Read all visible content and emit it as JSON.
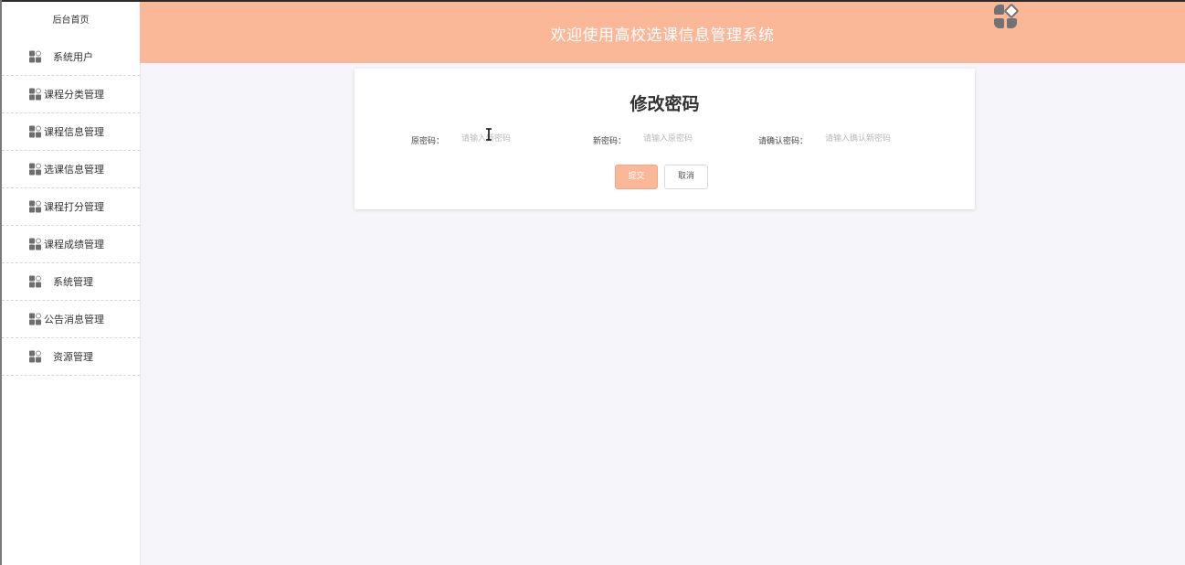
{
  "sidebar": {
    "home": "后台首页",
    "items": [
      {
        "label": "系统用户"
      },
      {
        "label": "课程分类管理"
      },
      {
        "label": "课程信息管理"
      },
      {
        "label": "选课信息管理"
      },
      {
        "label": "课程打分管理"
      },
      {
        "label": "课程成绩管理"
      },
      {
        "label": "系统管理"
      },
      {
        "label": "公告消息管理"
      },
      {
        "label": "资源管理"
      }
    ]
  },
  "header": {
    "title": "欢迎使用高校选课信息管理系统",
    "avatar_icon": "apps-grid-icon"
  },
  "form": {
    "title": "修改密码",
    "old_password": {
      "label": "原密码：",
      "placeholder": "请输入新密码",
      "value": ""
    },
    "new_password": {
      "label": "新密码：",
      "placeholder": "请输入原密码",
      "value": ""
    },
    "confirm_password": {
      "label": "请确认密码：",
      "placeholder": "请输入确认新密码",
      "value": ""
    },
    "submit_label": "提交",
    "cancel_label": "取消"
  },
  "colors": {
    "accent": "#fbb899",
    "background": "#f5f5fa",
    "sidebar_bg": "#ffffff"
  }
}
